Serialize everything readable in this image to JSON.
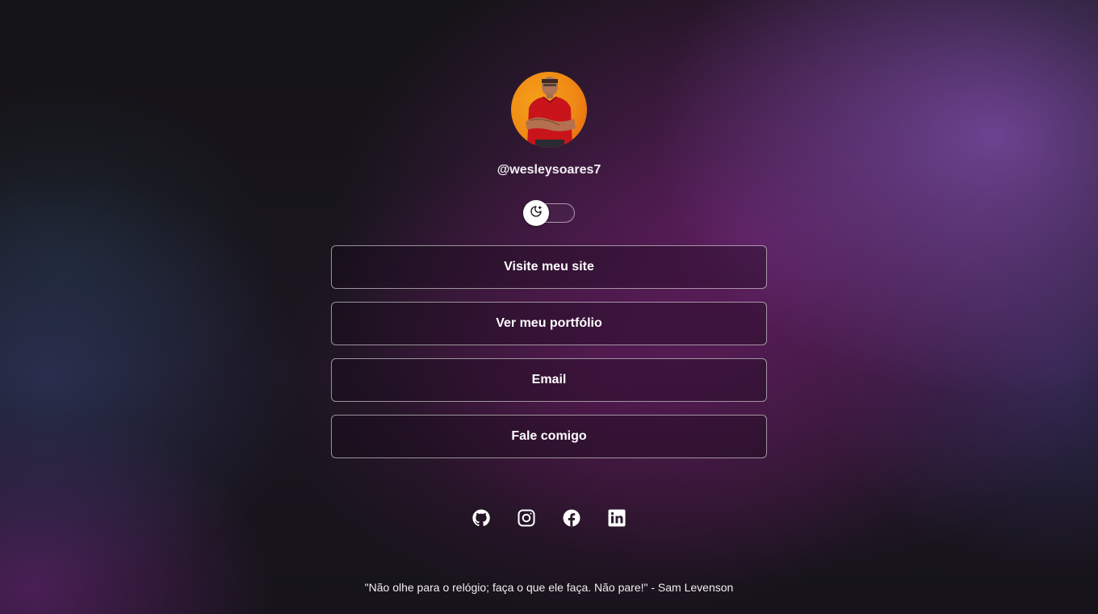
{
  "profile": {
    "username": "@wesleysoares7"
  },
  "theme_toggle": {
    "icon": "moon-stars-icon",
    "state": "dark"
  },
  "links": [
    {
      "label": "Visite meu site"
    },
    {
      "label": "Ver meu portfólio"
    },
    {
      "label": "Email"
    },
    {
      "label": "Fale comigo"
    }
  ],
  "socials": [
    {
      "icon": "github-icon"
    },
    {
      "icon": "instagram-icon"
    },
    {
      "icon": "facebook-icon"
    },
    {
      "icon": "linkedin-icon"
    }
  ],
  "footer": {
    "quote": "\"Não olhe para o relógio; faça o que ele faça. Não pare!\" - Sam Levenson"
  },
  "colors": {
    "accent_purple": "#6b2a7a",
    "avatar_bg": "#f08a14",
    "text": "#ffffff"
  }
}
